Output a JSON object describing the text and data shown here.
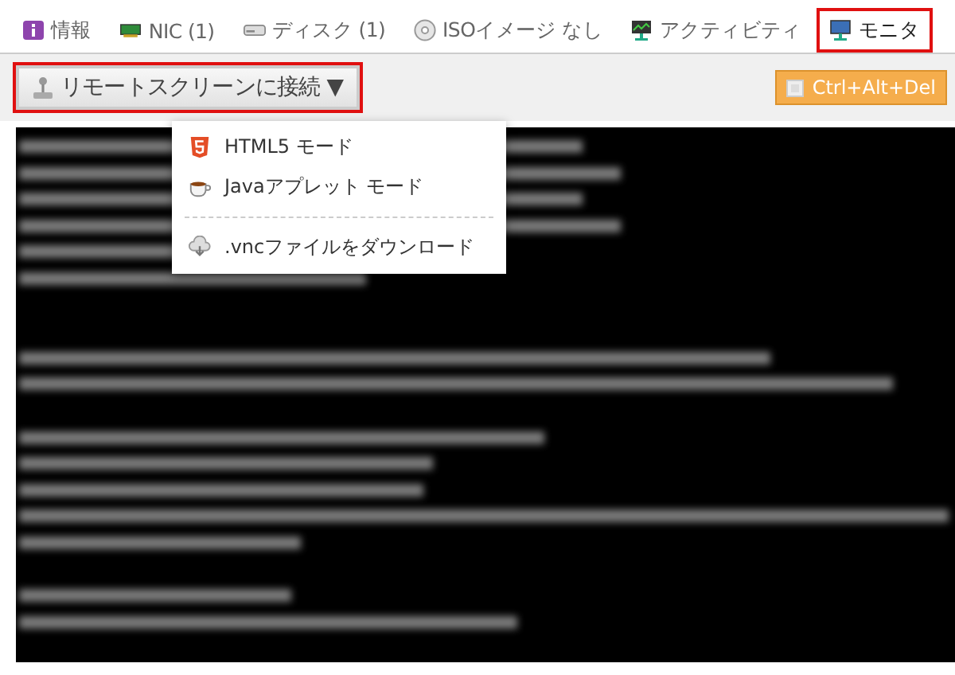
{
  "tabs": [
    {
      "kind": "info",
      "label": "情報",
      "selected": false,
      "highlighted": false
    },
    {
      "kind": "nic",
      "label": "NIC (1)",
      "selected": false,
      "highlighted": false
    },
    {
      "kind": "disk",
      "label": "ディスク (1)",
      "selected": false,
      "highlighted": false
    },
    {
      "kind": "iso",
      "label": "ISOイメージ なし",
      "selected": false,
      "highlighted": false
    },
    {
      "kind": "activity",
      "label": "アクティビティ",
      "selected": false,
      "highlighted": false
    },
    {
      "kind": "monitor",
      "label": "モニタ",
      "selected": true,
      "highlighted": true
    }
  ],
  "toolbar": {
    "connect_button": {
      "label": "リモートスクリーンに接続 ▼",
      "highlighted": true,
      "expanded": true
    },
    "ctrl_alt_del_button": {
      "label": "Ctrl+Alt+Del"
    }
  },
  "dropdown": {
    "items": [
      {
        "kind": "html5",
        "label": "HTML5 モード"
      },
      {
        "kind": "java",
        "label": "Javaアプレット モード"
      },
      {
        "kind": "separator"
      },
      {
        "kind": "download",
        "label": ".vncファイルをダウンロード"
      }
    ]
  }
}
